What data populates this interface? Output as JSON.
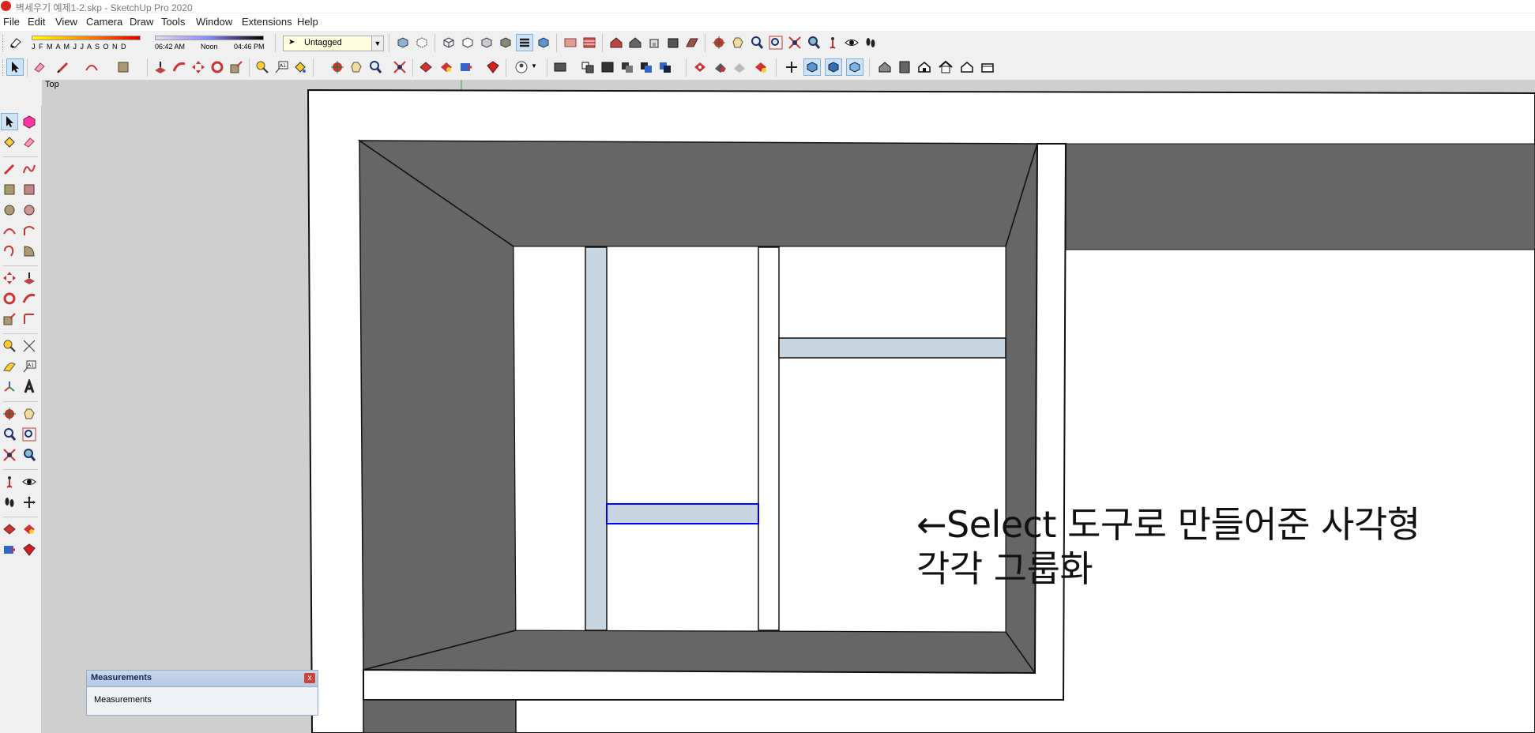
{
  "window": {
    "title": "벽세우기 예제1-2.skp - SketchUp Pro 2020",
    "app_icon": "sketchup-logo-icon"
  },
  "menu": [
    "File",
    "Edit",
    "View",
    "Camera",
    "Draw",
    "Tools",
    "Window",
    "Extensions",
    "Help"
  ],
  "shadow": {
    "months": "J F M A M J J A S O N D",
    "time_start": "06:42 AM",
    "time_mid": "Noon",
    "time_end": "04:46 PM"
  },
  "tag_select": {
    "value": "Untagged"
  },
  "viewport": {
    "scene_label": "Top"
  },
  "annotation": {
    "line1": "←Select 도구로 만들어준 사각형",
    "line2": "각각 그룹화"
  },
  "measurements": {
    "title": "Measurements",
    "close": "x",
    "label": "Measurements"
  },
  "colors": {
    "wall_dark": "#666666",
    "selection_blue": "#0000ff",
    "pale_blue": "#c8d6e2",
    "accent_red": "#d9261c"
  }
}
